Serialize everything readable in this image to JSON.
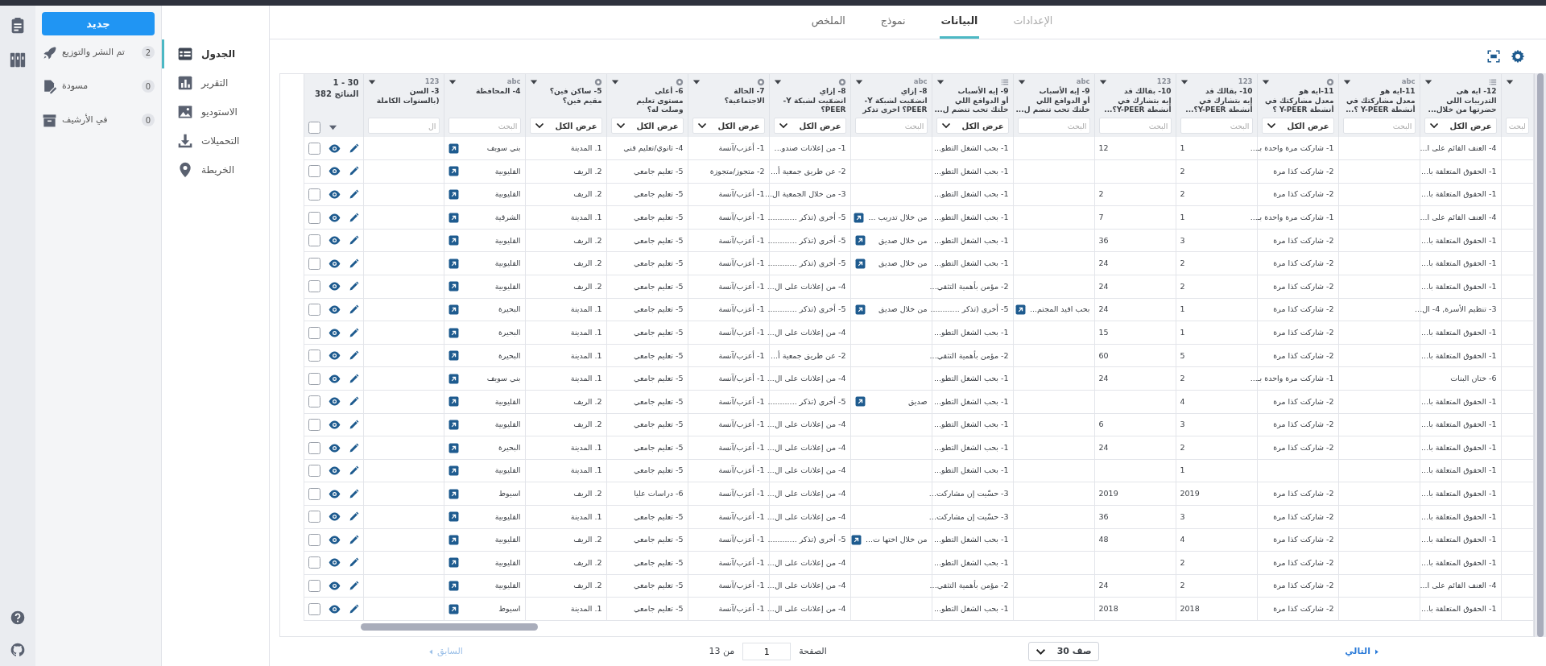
{
  "tabs": [
    {
      "label": "الإعدادات",
      "selected": false,
      "disabled": true
    },
    {
      "label": "البيانات",
      "selected": true,
      "disabled": false
    },
    {
      "label": "نموذج",
      "selected": false,
      "disabled": false
    },
    {
      "label": "الملخص",
      "selected": false,
      "disabled": false
    }
  ],
  "sidebar": {
    "new_button": "جديد",
    "items": [
      {
        "kind": "deployed",
        "label": "تم النشر والتوزيع",
        "count": "2"
      },
      {
        "kind": "draft",
        "label": "مسودة",
        "count": "0"
      },
      {
        "kind": "archived",
        "label": "في الأرشيف",
        "count": "0"
      }
    ]
  },
  "subnav": [
    {
      "kind": "table",
      "label": "الجدول",
      "selected": true
    },
    {
      "kind": "report",
      "label": "التقرير",
      "selected": false
    },
    {
      "kind": "gallery",
      "label": "الاستوديو",
      "selected": false
    },
    {
      "kind": "downloads",
      "label": "التحميلات",
      "selected": false
    },
    {
      "kind": "map",
      "label": "الخريطة",
      "selected": false
    }
  ],
  "table": {
    "range": "30 - 1",
    "total": "النتائج 382",
    "all_selected": false,
    "columns": [
      {
        "kind": "blank",
        "filter": {
          "kind": "search",
          "placeholder": "لبحث"
        }
      },
      {
        "kind": "list",
        "title_lines": [
          "12- ايه هى",
          "التدريبات اللى",
          "حضرتها من خلال..."
        ],
        "filter": {
          "kind": "select",
          "value": "عرض الكل"
        }
      },
      {
        "kind": "text",
        "type_label": "abc",
        "title_lines": [
          "11-ايه هو",
          "معدل مشاركتك في",
          "أنشطة Y-PEER ؟..."
        ],
        "filter": {
          "kind": "search",
          "placeholder": "البحث"
        }
      },
      {
        "kind": "radio",
        "title_lines": [
          "11-ايه هو",
          "معدل مشاركتك في",
          "أنشطة Y-PEER ؟"
        ],
        "filter": {
          "kind": "select",
          "value": "عرض الكل"
        }
      },
      {
        "kind": "number",
        "type_label": "123",
        "title_lines": [
          "10- بقالك قد",
          "إيه بتشارك في",
          "أنشطة Y-PEER؟..."
        ],
        "filter": {
          "kind": "search",
          "placeholder": "البحث"
        }
      },
      {
        "kind": "number",
        "type_label": "123",
        "title_lines": [
          "10- بقالك قد",
          "إيه بتشارك في",
          "أنشطة Y-PEER؟..."
        ],
        "filter": {
          "kind": "search",
          "placeholder": "البحث"
        }
      },
      {
        "kind": "text",
        "type_label": "abc",
        "title_lines": [
          "9- إيه الأسباب",
          "أو الدوافع اللي",
          "خلتك تحب تنضم ل..."
        ],
        "filter": {
          "kind": "search",
          "placeholder": "البحث"
        },
        "expandable": true
      },
      {
        "kind": "list",
        "title_lines": [
          "9- إيه الأسباب",
          "أو الدوافع اللي",
          "خلتك تحب تنضم ل..."
        ],
        "filter": {
          "kind": "select",
          "value": "عرض الكل"
        }
      },
      {
        "kind": "text",
        "type_label": "abc",
        "title_lines": [
          "8- إزاي",
          "انضمّيت لشبكة Y-",
          "PEER؟ اخرى تذكر"
        ],
        "filter": {
          "kind": "search",
          "placeholder": "البحث"
        },
        "expandable": true
      },
      {
        "kind": "radio",
        "title_lines": [
          "8- إزاي",
          "انضمّيت لشبكة Y-",
          "PEER؟"
        ],
        "filter": {
          "kind": "select",
          "value": "عرض الكل"
        }
      },
      {
        "kind": "radio",
        "title_lines": [
          "7- الحالة",
          "الاجتماعية؟"
        ],
        "filter": {
          "kind": "select",
          "value": "عرض الكل"
        }
      },
      {
        "kind": "radio",
        "title_lines": [
          "6- أعلى",
          "مستوى تعليم",
          "وصلت له؟"
        ],
        "filter": {
          "kind": "select",
          "value": "عرض الكل"
        }
      },
      {
        "kind": "radio",
        "title_lines": [
          "5- ساكن فين؟",
          "مقيم فين؟"
        ],
        "filter": {
          "kind": "select",
          "value": "عرض الكل"
        }
      },
      {
        "kind": "text",
        "type_label": "abc",
        "title_lines": [
          "4- المحافظة"
        ],
        "filter": {
          "kind": "search",
          "placeholder": "البحث"
        },
        "expandable": true
      },
      {
        "kind": "number",
        "type_label": "123",
        "title_lines": [
          "3- السن",
          "(بالسنوات الكاملة"
        ],
        "filter": {
          "kind": "search",
          "placeholder": "ال"
        }
      }
    ],
    "rows": [
      {
        "selected": false,
        "cells": [
          null,
          "4- العنف القائم على ا...",
          null,
          "1- شاركت مرة واحدة بـ...",
          "1",
          "12",
          null,
          "1- بحب الشغل التطو...",
          null,
          "1- من إعلانات صندو...",
          "1- أعزب/آنسة",
          "4- ثانوي/تعليم فني",
          "1. المدينة",
          "بني سويف",
          null
        ]
      },
      {
        "selected": false,
        "cells": [
          null,
          "1- الحقوق المتعلقة با...",
          null,
          "2- شاركت كذا مرة",
          "2",
          null,
          null,
          "1- بحب الشغل التطو...",
          null,
          "2- عن طريق جمعية أ...",
          "2- متجوز/متجوزة",
          "5- تعليم جامعي",
          "2. الريف",
          "القليوبية",
          null
        ]
      },
      {
        "selected": false,
        "cells": [
          null,
          "1- الحقوق المتعلقة با...",
          null,
          "2- شاركت كذا مرة",
          "2",
          "2",
          null,
          "1- بحب الشغل التطو...",
          null,
          "3- من خلال الجمعية ال...",
          "1- أعزب/آنسة",
          "5- تعليم جامعي",
          "2. الريف",
          "القليوبية",
          null
        ]
      },
      {
        "selected": false,
        "cells": [
          null,
          "4- العنف القائم على ا...",
          null,
          "1- شاركت مرة واحدة بـ...",
          "1",
          "7",
          null,
          "1- بحب الشغل التطو...",
          "من خلال تدريب ...",
          "5- أخرى (تذكر ............",
          "1- أعزب/آنسة",
          "5- تعليم جامعي",
          "1. المدينة",
          "الشرقية",
          null
        ]
      },
      {
        "selected": false,
        "cells": [
          null,
          "1- الحقوق المتعلقة با...",
          null,
          "2- شاركت كذا مرة",
          "3",
          "36",
          null,
          "1- بحب الشغل التطو...",
          "من خلال صديق",
          "5- أخرى (تذكر ............",
          "1- أعزب/آنسة",
          "5- تعليم جامعي",
          "2. الريف",
          "القليوبية",
          null
        ]
      },
      {
        "selected": false,
        "cells": [
          null,
          "1- الحقوق المتعلقة با...",
          null,
          "2- شاركت كذا مرة",
          "2",
          "24",
          null,
          "1- بحب الشغل التطو...",
          "من خلال صديق",
          "5- أخرى (تذكر ............",
          "1- أعزب/آنسة",
          "5- تعليم جامعي",
          "2. الريف",
          "القليوبية",
          null
        ]
      },
      {
        "selected": false,
        "cells": [
          null,
          "1- الحقوق المتعلقة با...",
          null,
          "2- شاركت كذا مرة",
          "2",
          "24",
          null,
          "2- مؤمن بأهمية التثقي...",
          null,
          "4- من إعلانات على ال...",
          "1- أعزب/آنسة",
          "5- تعليم جامعي",
          "2. الريف",
          "القليوبية",
          null
        ]
      },
      {
        "selected": false,
        "cells": [
          null,
          "3- تنظيم الأسرة, 4- ال...",
          null,
          "2- شاركت كذا مرة",
          "1",
          "24",
          "بحب افيد المجتم...",
          "5- أخرى (تذكر ............",
          "من خلال صديق",
          "5- أخرى (تذكر ............",
          "1- أعزب/آنسة",
          "5- تعليم جامعي",
          "1. المدينة",
          "البحيرة",
          null
        ]
      },
      {
        "selected": false,
        "cells": [
          null,
          "1- الحقوق المتعلقة با...",
          null,
          "2- شاركت كذا مرة",
          "1",
          "15",
          null,
          "1- بحب الشغل التطو...",
          null,
          "4- من إعلانات على ال...",
          "1- أعزب/آنسة",
          "5- تعليم جامعي",
          "1. المدينة",
          "البحيرة",
          null
        ]
      },
      {
        "selected": false,
        "cells": [
          null,
          "1- الحقوق المتعلقة با...",
          null,
          "2- شاركت كذا مرة",
          "5",
          "60",
          null,
          "2- مؤمن بأهمية التثقي...",
          null,
          "2- عن طريق جمعية أ...",
          "1- أعزب/آنسة",
          "5- تعليم جامعي",
          "1. المدينة",
          "البحيرة",
          null
        ]
      },
      {
        "selected": false,
        "cells": [
          null,
          "6- ختان البنات",
          null,
          "1- شاركت مرة واحدة بـ...",
          "2",
          "24",
          null,
          "1- بحب الشغل التطو...",
          null,
          "4- من إعلانات على ال...",
          "1- أعزب/آنسة",
          "5- تعليم جامعي",
          "1. المدينة",
          "بني سويف",
          null
        ]
      },
      {
        "selected": false,
        "cells": [
          null,
          "1- الحقوق المتعلقة با...",
          null,
          "2- شاركت كذا مرة",
          "4",
          null,
          null,
          "1- بحب الشغل التطو...",
          "صديق",
          "5- أخرى (تذكر ............",
          "1- أعزب/آنسة",
          "5- تعليم جامعي",
          "2. الريف",
          "القليوبية",
          null
        ]
      },
      {
        "selected": false,
        "cells": [
          null,
          "1- الحقوق المتعلقة با...",
          null,
          "2- شاركت كذا مرة",
          "3",
          "6",
          null,
          "1- بحب الشغل التطو...",
          null,
          "4- من إعلانات على ال...",
          "1- أعزب/آنسة",
          "5- تعليم جامعي",
          "2. الريف",
          "القليوبية",
          null
        ]
      },
      {
        "selected": false,
        "cells": [
          null,
          "1- الحقوق المتعلقة با...",
          null,
          "2- شاركت كذا مرة",
          "2",
          "24",
          null,
          "1- بحب الشغل التطو...",
          null,
          "4- من إعلانات على ال...",
          "1- أعزب/آنسة",
          "5- تعليم جامعي",
          "1. المدينة",
          "البحيرة",
          null
        ]
      },
      {
        "selected": false,
        "cells": [
          null,
          "1- الحقوق المتعلقة با...",
          null,
          null,
          "1",
          null,
          null,
          "1- بحب الشغل التطو...",
          null,
          "4- من إعلانات على ال...",
          "1- أعزب/آنسة",
          "5- تعليم جامعي",
          "1. المدينة",
          "القليوبية",
          null
        ]
      },
      {
        "selected": false,
        "cells": [
          null,
          "1- الحقوق المتعلقة با...",
          null,
          "2- شاركت كذا مرة",
          "2019",
          "2019",
          null,
          "3- حسّيت إن مشاركت...",
          null,
          "4- من إعلانات على ال...",
          "1- أعزب/آنسة",
          "6- دراسات عليا",
          "2. الريف",
          "اسيوط",
          null
        ]
      },
      {
        "selected": false,
        "cells": [
          null,
          "1- الحقوق المتعلقة با...",
          null,
          "2- شاركت كذا مرة",
          "3",
          "36",
          null,
          "3- حسّيت إن مشاركت...",
          null,
          "4- من إعلانات على ال...",
          "1- أعزب/آنسة",
          "5- تعليم جامعي",
          "1. المدينة",
          "القليوبية",
          null
        ]
      },
      {
        "selected": false,
        "cells": [
          null,
          "1- الحقوق المتعلقة با...",
          null,
          "2- شاركت كذا مرة",
          "4",
          "48",
          null,
          "1- بحب الشغل التطو...",
          "من خلال اختها ت...",
          "5- أخرى (تذكر ............",
          "1- أعزب/آنسة",
          "5- تعليم جامعي",
          "2. الريف",
          "القليوبية",
          null
        ]
      },
      {
        "selected": false,
        "cells": [
          null,
          "1- الحقوق المتعلقة با...",
          null,
          "2- شاركت كذا مرة",
          "2",
          null,
          null,
          "1- بحب الشغل التطو...",
          null,
          "4- من إعلانات على ال...",
          "1- أعزب/آنسة",
          "5- تعليم جامعي",
          "2. الريف",
          "القليوبية",
          null
        ]
      },
      {
        "selected": false,
        "cells": [
          null,
          "4- العنف القائم على ا...",
          null,
          "2- شاركت كذا مرة",
          "2",
          "24",
          null,
          "2- مؤمن بأهمية التثقي...",
          null,
          "4- من إعلانات على ال...",
          "1- أعزب/آنسة",
          "5- تعليم جامعي",
          "2. الريف",
          "القليوبية",
          null
        ]
      },
      {
        "selected": false,
        "cells": [
          null,
          "1- الحقوق المتعلقة با...",
          null,
          "2- شاركت كذا مرة",
          "2018",
          "2018",
          null,
          "1- بحب الشغل التطو...",
          null,
          "4- من إعلانات على ال...",
          "1- أعزب/آنسة",
          "5- تعليم جامعي",
          "1. المدينة",
          "اسيوط",
          null
        ]
      }
    ]
  },
  "pager": {
    "next": {
      "label": "التالي",
      "disabled": false
    },
    "rows_select": "صف 30",
    "page_label": "الصفحة",
    "page": "1",
    "of": "من 13",
    "prev": {
      "label": "السابق",
      "disabled": true
    }
  }
}
